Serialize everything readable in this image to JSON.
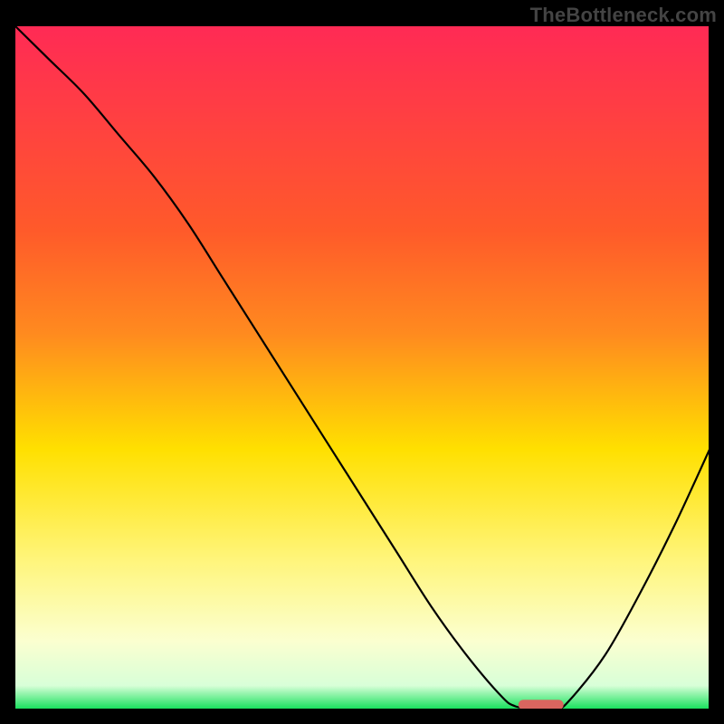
{
  "watermark": "TheBottleneck.com",
  "chart_data": {
    "type": "line",
    "title": "",
    "xlabel": "",
    "ylabel": "",
    "xlim": [
      0,
      100
    ],
    "ylim": [
      0,
      100
    ],
    "x": [
      0,
      5,
      10,
      15,
      20,
      25,
      30,
      35,
      40,
      45,
      50,
      55,
      60,
      65,
      70,
      72,
      75,
      78,
      80,
      85,
      90,
      95,
      100
    ],
    "values": [
      100,
      95,
      90,
      84,
      78,
      71,
      63,
      55,
      47,
      39,
      31,
      23,
      15,
      8,
      2,
      0.5,
      0,
      0,
      1.5,
      8,
      17,
      27,
      38
    ],
    "marker": {
      "x_start": 72.5,
      "x_end": 79,
      "y": 0.7
    },
    "colors": {
      "gradient_top": "#ff2a55",
      "gradient_mid_upper": "#ff8a1f",
      "gradient_mid": "#ffe000",
      "gradient_mid_lower": "#fff57a",
      "gradient_lower": "#fbffd0",
      "gradient_bottom": "#12e05a",
      "curve": "#000000",
      "marker": "#d9655f",
      "frame": "#000000"
    }
  }
}
